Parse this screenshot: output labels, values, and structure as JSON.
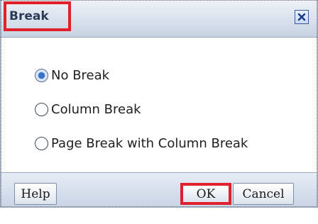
{
  "dialog": {
    "title": "Break",
    "close_icon": "close-icon"
  },
  "options": [
    {
      "label": "No Break",
      "checked": true
    },
    {
      "label": "Column Break",
      "checked": false
    },
    {
      "label": "Page Break with Column Break",
      "checked": false
    }
  ],
  "buttons": {
    "help": "Help",
    "ok": "OK",
    "cancel": "Cancel"
  },
  "colors": {
    "highlight": "#e0202a",
    "title_text": "#2b3a55",
    "radio_selected": "#3b74c7"
  }
}
